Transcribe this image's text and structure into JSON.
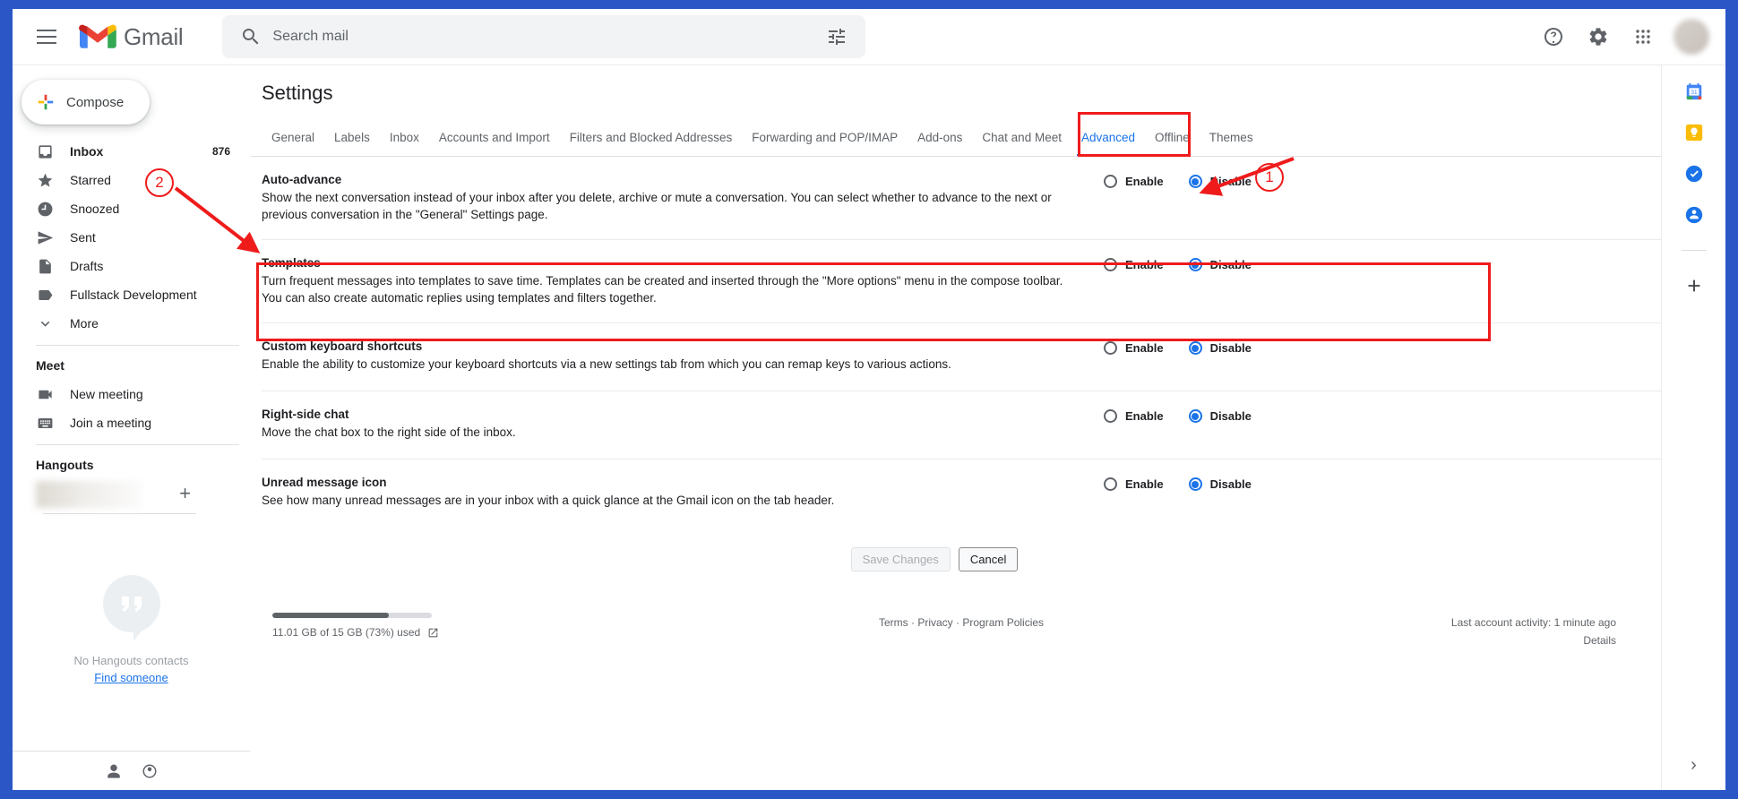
{
  "header": {
    "brand": "Gmail",
    "menu_icon": "hamburger-icon",
    "search": {
      "placeholder": "Search mail",
      "value": ""
    },
    "help_title": "Support",
    "settings_title": "Settings",
    "apps_title": "Google apps"
  },
  "sidebar": {
    "compose_label": "Compose",
    "items": [
      {
        "label": "Inbox",
        "count": "876",
        "icon": "inbox-icon",
        "active": true
      },
      {
        "label": "Starred",
        "count": "",
        "icon": "star-icon",
        "active": false
      },
      {
        "label": "Snoozed",
        "count": "",
        "icon": "clock-icon",
        "active": false
      },
      {
        "label": "Sent",
        "count": "",
        "icon": "send-icon",
        "active": false
      },
      {
        "label": "Drafts",
        "count": "",
        "icon": "draft-icon",
        "active": false
      },
      {
        "label": "Fullstack Development",
        "count": "",
        "icon": "label-icon",
        "active": false
      },
      {
        "label": "More",
        "count": "",
        "icon": "chevron-down-icon",
        "active": false
      }
    ],
    "meet": {
      "title": "Meet",
      "items": [
        {
          "label": "New meeting",
          "icon": "video-camera-icon"
        },
        {
          "label": "Join a meeting",
          "icon": "keyboard-icon"
        }
      ]
    },
    "hangouts": {
      "title": "Hangouts",
      "account_name": "",
      "add_label": "+",
      "empty_text": "No Hangouts contacts",
      "find_link": "Find someone"
    }
  },
  "main": {
    "page_title": "Settings",
    "tabs": [
      {
        "label": "General",
        "active": false
      },
      {
        "label": "Labels",
        "active": false
      },
      {
        "label": "Inbox",
        "active": false
      },
      {
        "label": "Accounts and Import",
        "active": false
      },
      {
        "label": "Filters and Blocked Addresses",
        "active": false
      },
      {
        "label": "Forwarding and POP/IMAP",
        "active": false
      },
      {
        "label": "Add-ons",
        "active": false
      },
      {
        "label": "Chat and Meet",
        "active": false
      },
      {
        "label": "Advanced",
        "active": true
      },
      {
        "label": "Offline",
        "active": false
      },
      {
        "label": "Themes",
        "active": false
      }
    ],
    "option_labels": {
      "enable": "Enable",
      "disable": "Disable"
    },
    "settings": [
      {
        "name": "Auto-advance",
        "description": "Show the next conversation instead of your inbox after you delete, archive or mute a conversation. You can select whether to advance to the next or previous conversation in the \"General\" Settings page.",
        "selected": "Disable"
      },
      {
        "name": "Templates",
        "description": "Turn frequent messages into templates to save time. Templates can be created and inserted through the \"More options\" menu in the compose toolbar. You can also create automatic replies using templates and filters together.",
        "selected": "Disable"
      },
      {
        "name": "Custom keyboard shortcuts",
        "description": "Enable the ability to customize your keyboard shortcuts via a new settings tab from which you can remap keys to various actions.",
        "selected": "Disable"
      },
      {
        "name": "Right-side chat",
        "description": "Move the chat box to the right side of the inbox.",
        "selected": "Disable"
      },
      {
        "name": "Unread message icon",
        "description": "See how many unread messages are in your inbox with a quick glance at the Gmail icon on the tab header.",
        "selected": "Disable"
      }
    ],
    "buttons": {
      "save": "Save Changes",
      "cancel": "Cancel"
    }
  },
  "footer": {
    "storage_text": "11.01 GB of 15 GB (73%) used",
    "storage_percent": 73,
    "links": [
      "Terms",
      "Privacy",
      "Program Policies"
    ],
    "separator": "·",
    "activity": "Last account activity: 1 minute ago",
    "details": "Details"
  },
  "right_rail": {
    "icons": [
      "calendar-icon",
      "keep-icon",
      "tasks-icon",
      "contacts-icon",
      "add-icon"
    ],
    "expand_label": "›"
  },
  "annotations": [
    {
      "id": "1",
      "label": "1",
      "target": "advanced-tab"
    },
    {
      "id": "2",
      "label": "2",
      "target": "templates-row"
    }
  ],
  "colors": {
    "accent": "#1a73e8",
    "annotation": "#ef1b1b",
    "text": "#202124",
    "muted": "#5f6368",
    "browser_chrome": "#2a56c6"
  }
}
